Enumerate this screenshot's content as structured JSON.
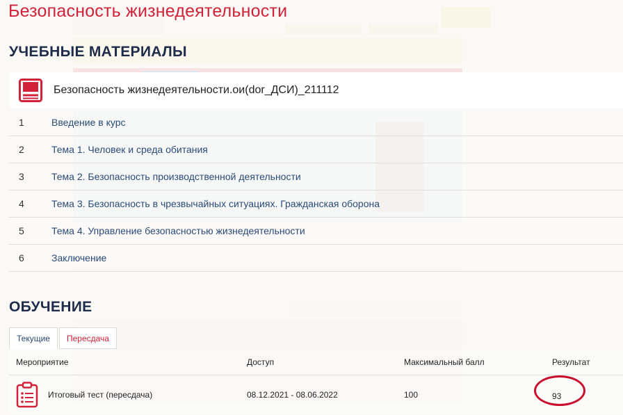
{
  "page": {
    "title": "Безопасность жизнедеятельности"
  },
  "materials": {
    "title": "УЧЕБНЫЕ МАТЕРИАЛЫ",
    "course": {
      "name": "Безопасность жизнедеятельности.ои(dor_ДСИ)_211112",
      "icon": "book-icon"
    },
    "topics": [
      {
        "num": "1",
        "label": "Введение в курс"
      },
      {
        "num": "2",
        "label": "Тема 1. Человек и среда обитания"
      },
      {
        "num": "3",
        "label": "Тема 2. Безопасность производственной деятельности"
      },
      {
        "num": "4",
        "label": "Тема 3. Безопасность в чрезвычайных ситуациях. Гражданская оборона"
      },
      {
        "num": "5",
        "label": "Тема 4. Управление безопасностью жизнедеятельности"
      },
      {
        "num": "6",
        "label": "Заключение"
      }
    ]
  },
  "learning": {
    "title": "ОБУЧЕНИЕ",
    "tabs": [
      {
        "label": "Текущие"
      },
      {
        "label": "Пересдача"
      }
    ],
    "table": {
      "headers": {
        "event": "Мероприятие",
        "access": "Доступ",
        "max": "Максимальный балл",
        "result": "Результат"
      },
      "rows": [
        {
          "event": "Итоговый тест (пересдача)",
          "access": "08.12.2021 - 08.06.2022",
          "max": "100",
          "result": "93",
          "icon": "test-clipboard-icon"
        }
      ]
    }
  },
  "colors": {
    "accent_red": "#d2223a",
    "heading_navy": "#1f2c4a",
    "link_blue": "#2b4a7a",
    "circle_red": "#c8102e"
  }
}
